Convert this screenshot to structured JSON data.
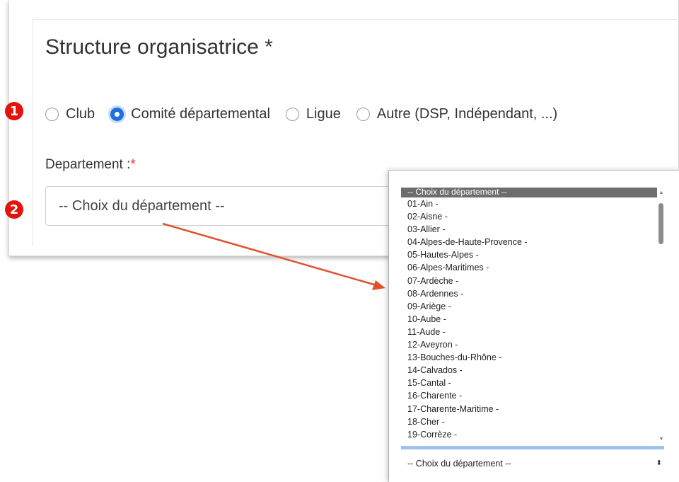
{
  "form": {
    "title": "Structure organisatrice *",
    "radios": [
      {
        "label": "Club",
        "checked": false
      },
      {
        "label": "Comité départemental",
        "checked": true
      },
      {
        "label": "Ligue",
        "checked": false
      },
      {
        "label": "Autre (DSP, Indépendant, ...)",
        "checked": false
      }
    ],
    "department_label": "Departement :",
    "required_mark": "*",
    "department_value": "-- Choix du département --"
  },
  "markers": [
    "1",
    "2"
  ],
  "dropdown": {
    "options": [
      "-- Choix du département --",
      "01-Ain -",
      "02-Aisne -",
      "03-Allier -",
      "04-Alpes-de-Haute-Provence -",
      "05-Hautes-Alpes -",
      "06-Alpes-Maritimes -",
      "07-Ardèche -",
      "08-Ardennes -",
      "09-Ariège -",
      "10-Aube -",
      "11-Aude -",
      "12-Aveyron -",
      "13-Bouches-du-Rhône -",
      "14-Calvados -",
      "15-Cantal -",
      "16-Charente -",
      "17-Charente-Maritime -",
      "18-Cher -",
      "19-Corrèze -"
    ],
    "selected_index": 0,
    "current_value": "-- Choix du département --"
  },
  "colors": {
    "accent": "#1f6fe0",
    "marker": "#e3120b",
    "arrow": "#e0522f",
    "required": "#e0332a"
  }
}
